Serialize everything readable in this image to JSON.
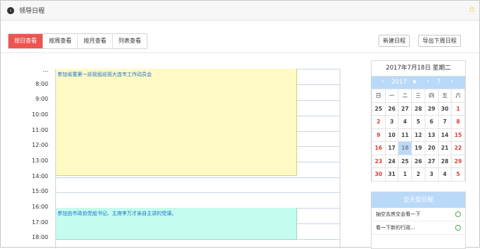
{
  "header": {
    "title": "领导日程",
    "star": "☆"
  },
  "view_tabs": [
    "按日查看",
    "按周查看",
    "按月查看",
    "列表查看"
  ],
  "actions": {
    "new_schedule": "新建日程",
    "export_next_week": "导出下周日程"
  },
  "day_view": {
    "hours": [
      "...",
      "8:00",
      "9:00",
      "10:00",
      "11:00",
      "12:00",
      "13:00",
      "14:00",
      "15:00",
      "16:00",
      "17:00",
      "18:00"
    ],
    "events": [
      {
        "text": "参加省委第一巡视组巡视大连市工作动员会",
        "color": "#fff9c4"
      },
      {
        "text": "参加由市政协党组书记、主席李万才亲自主讲的党课。",
        "color": "#c4fcef"
      }
    ]
  },
  "mini_calendar": {
    "header": "2017年7月18日 星期二",
    "year": "2017",
    "month": "7",
    "prev_year": "‹",
    "next_year": "›",
    "prev_month": "‹",
    "next_month": "›",
    "weekdays": [
      "日",
      "一",
      "二",
      "三",
      "四",
      "五",
      "六"
    ],
    "weeks": [
      [
        "25",
        "26",
        "27",
        "28",
        "29",
        "30",
        "1"
      ],
      [
        "2",
        "3",
        "4",
        "5",
        "6",
        "7",
        "8"
      ],
      [
        "9",
        "10",
        "11",
        "12",
        "13",
        "14",
        "15"
      ],
      [
        "16",
        "17",
        "18",
        "19",
        "20",
        "21",
        "22"
      ],
      [
        "23",
        "24",
        "25",
        "26",
        "27",
        "28",
        "29"
      ],
      [
        "30",
        "31",
        "1",
        "2",
        "3",
        "4",
        "5"
      ]
    ],
    "today": "18"
  },
  "all_day": {
    "title": "全天型日程",
    "items": [
      "抽空去房交会看一下",
      "看一下新的行政..."
    ]
  }
}
